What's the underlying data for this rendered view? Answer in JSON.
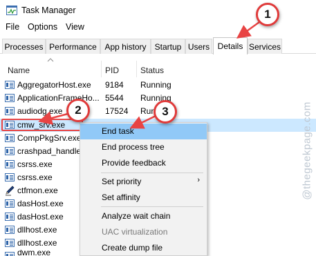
{
  "window": {
    "title": "Task Manager",
    "icon": "task-manager-icon"
  },
  "menu": {
    "items": [
      "File",
      "Options",
      "View"
    ]
  },
  "tabs": [
    {
      "label": "Processes",
      "active": false
    },
    {
      "label": "Performance",
      "active": false
    },
    {
      "label": "App history",
      "active": false
    },
    {
      "label": "Startup",
      "active": false
    },
    {
      "label": "Users",
      "active": false
    },
    {
      "label": "Details",
      "active": true
    },
    {
      "label": "Services",
      "active": false
    }
  ],
  "columns": {
    "name": "Name",
    "pid": "PID",
    "status": "Status"
  },
  "rows": [
    {
      "name": "AggregatorHost.exe",
      "pid": "9184",
      "status": "Running",
      "icon": "process-icon"
    },
    {
      "name": "ApplicationFrameHo...",
      "pid": "5544",
      "status": "Running",
      "icon": "process-icon"
    },
    {
      "name": "audiodg.exe",
      "pid": "17524",
      "status": "Running",
      "icon": "process-icon"
    },
    {
      "name": "cmw_srv.exe",
      "pid": "",
      "status": "",
      "icon": "process-icon",
      "selected": true
    },
    {
      "name": "CompPkgSrv.exe",
      "pid": "",
      "status": "",
      "icon": "process-icon"
    },
    {
      "name": "crashpad_handler.exe",
      "pid": "",
      "status": "",
      "icon": "process-icon"
    },
    {
      "name": "csrss.exe",
      "pid": "",
      "status": "",
      "icon": "process-icon"
    },
    {
      "name": "csrss.exe",
      "pid": "",
      "status": "",
      "icon": "process-icon"
    },
    {
      "name": "ctfmon.exe",
      "pid": "",
      "status": "",
      "icon": "pen-icon"
    },
    {
      "name": "dasHost.exe",
      "pid": "",
      "status": "",
      "icon": "process-icon"
    },
    {
      "name": "dasHost.exe",
      "pid": "",
      "status": "",
      "icon": "process-icon"
    },
    {
      "name": "dllhost.exe",
      "pid": "",
      "status": "",
      "icon": "process-icon"
    },
    {
      "name": "dllhost.exe",
      "pid": "",
      "status": "",
      "icon": "process-icon"
    },
    {
      "name": "dwm.exe",
      "pid": "",
      "status": "",
      "icon": "process-icon"
    }
  ],
  "context_menu": {
    "items": [
      {
        "label": "End task",
        "highlighted": true
      },
      {
        "label": "End process tree"
      },
      {
        "label": "Provide feedback"
      },
      {
        "label": "Set priority",
        "submenu": true,
        "submenu_glyph": "›"
      },
      {
        "label": "Set affinity"
      },
      {
        "label": "Analyze wait chain"
      },
      {
        "label": "UAC virtualization",
        "disabled": true
      },
      {
        "label": "Create dump file"
      }
    ]
  },
  "callouts": [
    "1",
    "2",
    "3"
  ],
  "watermark": "@thegeekpage.com",
  "colors": {
    "selected_row": "#cce8ff",
    "menu_highlight": "#91c9f7",
    "callout_border": "#e03a3a",
    "arrow": "#e84444"
  }
}
